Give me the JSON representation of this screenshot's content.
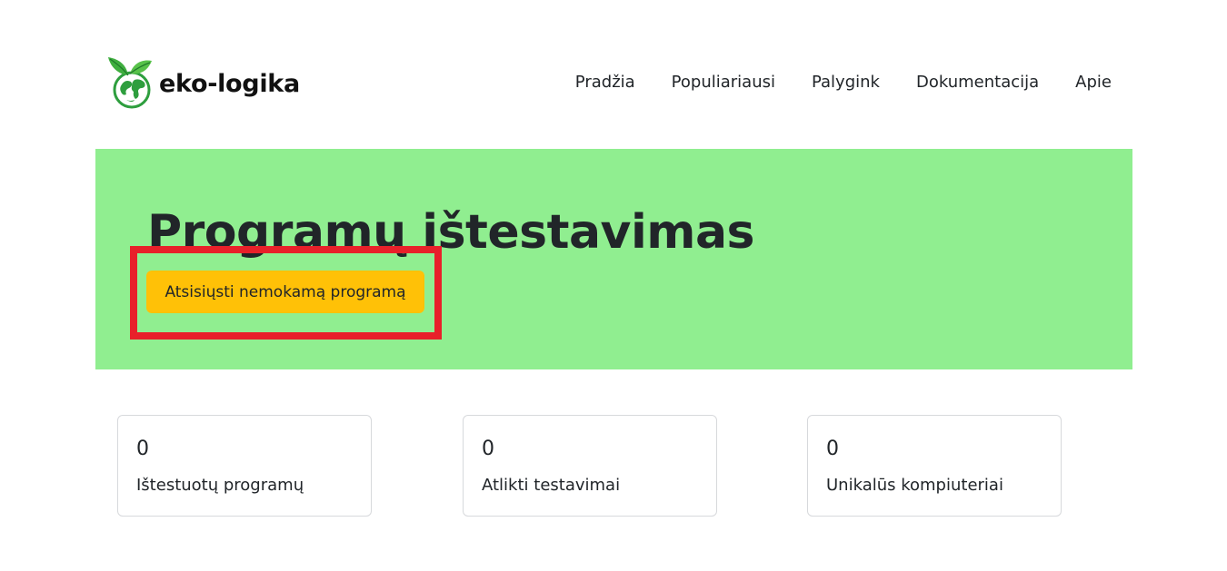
{
  "brand": {
    "name": "eko-logika",
    "logo_icon": "globe-leaf-icon"
  },
  "nav": {
    "items": [
      "Pradžia",
      "Populiariausi",
      "Palygink",
      "Dokumentacija",
      "Apie"
    ]
  },
  "hero": {
    "title": "Programų ištestavimas",
    "download_label": "Atsisiųsti nemokamą programą",
    "background": "#90ee90",
    "button_color": "#ffc107",
    "highlight_color": "#e8202a"
  },
  "stats": [
    {
      "value": "0",
      "label": "Ištestuotų programų"
    },
    {
      "value": "0",
      "label": "Atlikti testavimai"
    },
    {
      "value": "0",
      "label": "Unikalūs kompiuteriai"
    }
  ]
}
